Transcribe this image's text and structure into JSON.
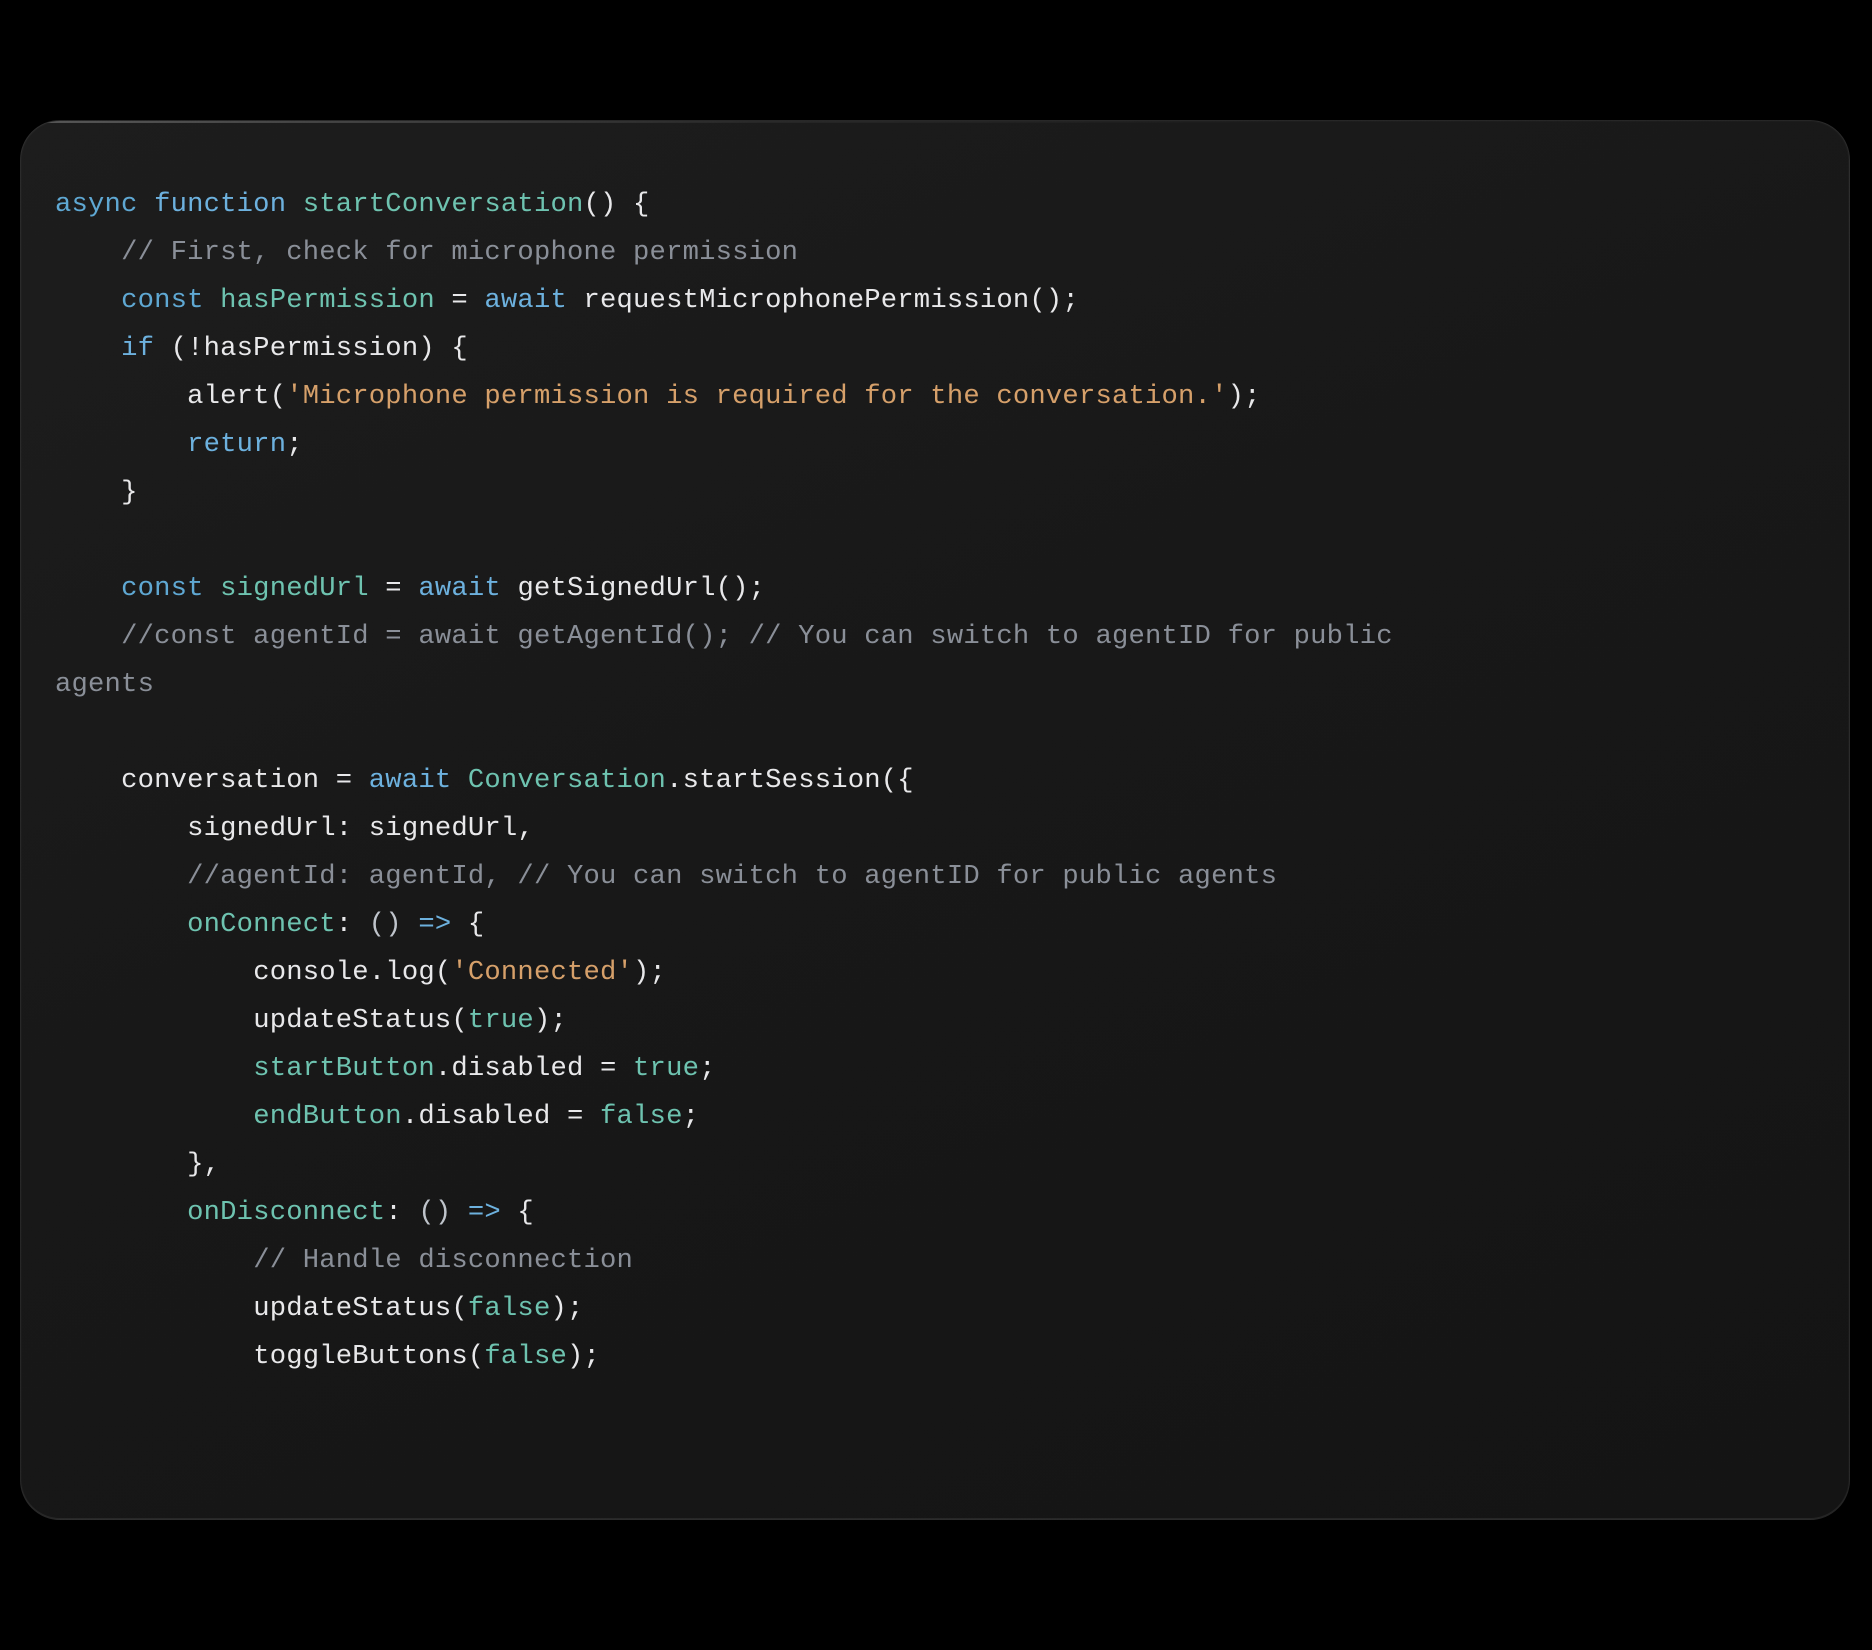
{
  "code": {
    "indent": "    ",
    "lines": [
      {
        "indent": 0,
        "tokens": [
          {
            "t": "async ",
            "c": "tok-kw-decl"
          },
          {
            "t": "function ",
            "c": "tok-kw-fn"
          },
          {
            "t": "startConversation",
            "c": "tok-id-teal"
          },
          {
            "t": "()",
            "c": "tok-plain"
          },
          {
            "t": " {",
            "c": "tok-plain"
          }
        ]
      },
      {
        "indent": 1,
        "tokens": [
          {
            "t": "// First, check for microphone permission",
            "c": "tok-cmt"
          }
        ]
      },
      {
        "indent": 1,
        "tokens": [
          {
            "t": "const ",
            "c": "tok-kw-decl"
          },
          {
            "t": "hasPermission",
            "c": "tok-id-teal"
          },
          {
            "t": " = ",
            "c": "tok-plain"
          },
          {
            "t": "await ",
            "c": "tok-kw-flow"
          },
          {
            "t": "requestMicrophonePermission",
            "c": "tok-call"
          },
          {
            "t": "();",
            "c": "tok-plain"
          }
        ]
      },
      {
        "indent": 1,
        "tokens": [
          {
            "t": "if ",
            "c": "tok-kw-flow"
          },
          {
            "t": "(!",
            "c": "tok-plain"
          },
          {
            "t": "hasPermission",
            "c": "tok-plain"
          },
          {
            "t": ") {",
            "c": "tok-plain"
          }
        ]
      },
      {
        "indent": 2,
        "tokens": [
          {
            "t": "alert",
            "c": "tok-call"
          },
          {
            "t": "(",
            "c": "tok-plain"
          },
          {
            "t": "'Microphone permission is required for the conversation.'",
            "c": "tok-str"
          },
          {
            "t": ");",
            "c": "tok-plain"
          }
        ]
      },
      {
        "indent": 2,
        "tokens": [
          {
            "t": "return",
            "c": "tok-kw-flow"
          },
          {
            "t": ";",
            "c": "tok-plain"
          }
        ]
      },
      {
        "indent": 1,
        "tokens": [
          {
            "t": "}",
            "c": "tok-plain"
          }
        ]
      },
      {
        "indent": 0,
        "tokens": []
      },
      {
        "indent": 1,
        "tokens": [
          {
            "t": "const ",
            "c": "tok-kw-decl"
          },
          {
            "t": "signedUrl",
            "c": "tok-id-teal"
          },
          {
            "t": " = ",
            "c": "tok-plain"
          },
          {
            "t": "await ",
            "c": "tok-kw-flow"
          },
          {
            "t": "getSignedUrl",
            "c": "tok-call"
          },
          {
            "t": "();",
            "c": "tok-plain"
          }
        ]
      },
      {
        "indent": 1,
        "tokens": [
          {
            "t": "//const agentId = await getAgentId(); // You can switch to agentID for public ",
            "c": "tok-cmt"
          }
        ]
      },
      {
        "indent": 0,
        "tokens": [
          {
            "t": "agents",
            "c": "tok-cmt"
          }
        ]
      },
      {
        "indent": 0,
        "tokens": []
      },
      {
        "indent": 1,
        "tokens": [
          {
            "t": "conversation",
            "c": "tok-plain"
          },
          {
            "t": " = ",
            "c": "tok-plain"
          },
          {
            "t": "await ",
            "c": "tok-kw-flow"
          },
          {
            "t": "Conversation",
            "c": "tok-id-teal"
          },
          {
            "t": ".",
            "c": "tok-plain"
          },
          {
            "t": "startSession",
            "c": "tok-call"
          },
          {
            "t": "({",
            "c": "tok-plain"
          }
        ]
      },
      {
        "indent": 2,
        "tokens": [
          {
            "t": "signedUrl",
            "c": "tok-plain"
          },
          {
            "t": ": ",
            "c": "tok-plain"
          },
          {
            "t": "signedUrl",
            "c": "tok-plain"
          },
          {
            "t": ",",
            "c": "tok-plain"
          }
        ]
      },
      {
        "indent": 2,
        "tokens": [
          {
            "t": "//agentId: agentId, // You can switch to agentID for public agents",
            "c": "tok-cmt"
          }
        ]
      },
      {
        "indent": 2,
        "tokens": [
          {
            "t": "onConnect",
            "c": "tok-id-teal"
          },
          {
            "t": ": ",
            "c": "tok-plain"
          },
          {
            "t": "()",
            "c": "tok-soft"
          },
          {
            "t": " ",
            "c": "tok-plain"
          },
          {
            "t": "=>",
            "c": "tok-op"
          },
          {
            "t": " {",
            "c": "tok-plain"
          }
        ]
      },
      {
        "indent": 3,
        "tokens": [
          {
            "t": "console",
            "c": "tok-plain"
          },
          {
            "t": ".",
            "c": "tok-plain"
          },
          {
            "t": "log",
            "c": "tok-call"
          },
          {
            "t": "(",
            "c": "tok-plain"
          },
          {
            "t": "'Connected'",
            "c": "tok-str"
          },
          {
            "t": ");",
            "c": "tok-plain"
          }
        ]
      },
      {
        "indent": 3,
        "tokens": [
          {
            "t": "updateStatus",
            "c": "tok-call"
          },
          {
            "t": "(",
            "c": "tok-plain"
          },
          {
            "t": "true",
            "c": "tok-num-bool"
          },
          {
            "t": ");",
            "c": "tok-plain"
          }
        ]
      },
      {
        "indent": 3,
        "tokens": [
          {
            "t": "startButton",
            "c": "tok-id-teal"
          },
          {
            "t": ".",
            "c": "tok-plain"
          },
          {
            "t": "disabled",
            "c": "tok-plain"
          },
          {
            "t": " = ",
            "c": "tok-plain"
          },
          {
            "t": "true",
            "c": "tok-num-bool"
          },
          {
            "t": ";",
            "c": "tok-plain"
          }
        ]
      },
      {
        "indent": 3,
        "tokens": [
          {
            "t": "endButton",
            "c": "tok-id-teal"
          },
          {
            "t": ".",
            "c": "tok-plain"
          },
          {
            "t": "disabled",
            "c": "tok-plain"
          },
          {
            "t": " = ",
            "c": "tok-plain"
          },
          {
            "t": "false",
            "c": "tok-num-bool"
          },
          {
            "t": ";",
            "c": "tok-plain"
          }
        ]
      },
      {
        "indent": 2,
        "tokens": [
          {
            "t": "},",
            "c": "tok-plain"
          }
        ]
      },
      {
        "indent": 2,
        "tokens": [
          {
            "t": "onDisconnect",
            "c": "tok-id-teal"
          },
          {
            "t": ": ",
            "c": "tok-plain"
          },
          {
            "t": "()",
            "c": "tok-soft"
          },
          {
            "t": " ",
            "c": "tok-plain"
          },
          {
            "t": "=>",
            "c": "tok-op"
          },
          {
            "t": " {",
            "c": "tok-plain"
          }
        ]
      },
      {
        "indent": 3,
        "tokens": [
          {
            "t": "// Handle disconnection",
            "c": "tok-cmt"
          }
        ]
      },
      {
        "indent": 3,
        "tokens": [
          {
            "t": "updateStatus",
            "c": "tok-call"
          },
          {
            "t": "(",
            "c": "tok-plain"
          },
          {
            "t": "false",
            "c": "tok-num-bool"
          },
          {
            "t": ");",
            "c": "tok-plain"
          }
        ]
      },
      {
        "indent": 3,
        "tokens": [
          {
            "t": "toggleButtons",
            "c": "tok-call"
          },
          {
            "t": "(",
            "c": "tok-plain"
          },
          {
            "t": "false",
            "c": "tok-num-bool"
          },
          {
            "t": ");",
            "c": "tok-plain"
          }
        ]
      }
    ]
  }
}
